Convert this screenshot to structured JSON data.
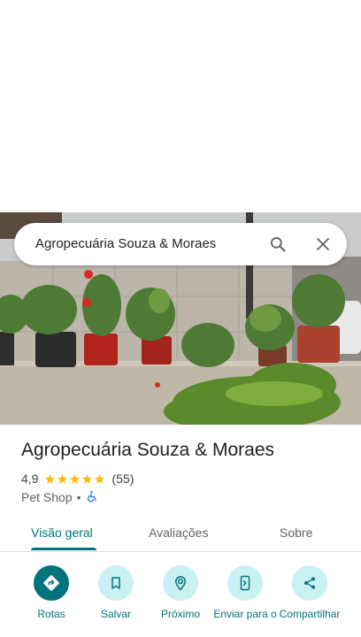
{
  "search": {
    "query": "Agropecuária Souza & Moraes",
    "search_icon": "search-icon",
    "close_icon": "close-icon"
  },
  "place": {
    "name": "Agropecuária Souza & Moraes",
    "rating": "4,9",
    "stars": 5,
    "review_count": "(55)",
    "category": "Pet Shop",
    "separator": "•",
    "accessibility_icon": "wheelchair-icon"
  },
  "tabs": [
    {
      "label": "Visão geral",
      "active": true
    },
    {
      "label": "Avaliações",
      "active": false
    },
    {
      "label": "Sobre",
      "active": false
    }
  ],
  "actions": [
    {
      "label": "Rotas",
      "icon": "directions-icon"
    },
    {
      "label": "Salvar",
      "icon": "bookmark-icon"
    },
    {
      "label": "Próximo",
      "icon": "nearby-icon"
    },
    {
      "label": "Enviar para o",
      "icon": "send-to-phone-icon"
    },
    {
      "label": "Compartilhar",
      "icon": "share-icon"
    }
  ],
  "colors": {
    "accent": "#00747a",
    "action_bg": "#c9f1f3",
    "star": "#fbbc04",
    "accessibility": "#1a73e8"
  }
}
